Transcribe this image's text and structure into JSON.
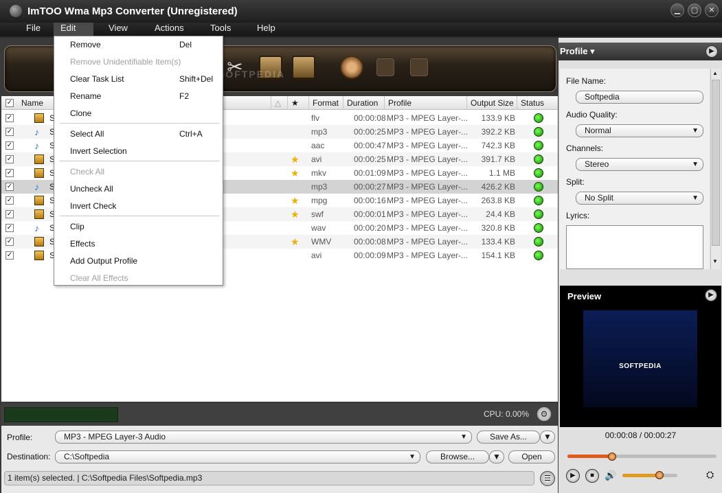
{
  "window": {
    "title": "ImTOO Wma Mp3 Converter (Unregistered)"
  },
  "menubar": [
    "File",
    "Edit",
    "View",
    "Actions",
    "Tools",
    "Help"
  ],
  "edit_menu": {
    "items": [
      {
        "label": "Remove",
        "shortcut": "Del",
        "disabled": false
      },
      {
        "label": "Remove Unidentifiable Item(s)",
        "shortcut": "",
        "disabled": true
      },
      {
        "label": "Clear Task List",
        "shortcut": "Shift+Del",
        "disabled": false
      },
      {
        "label": "Rename",
        "shortcut": "F2",
        "disabled": false
      },
      {
        "label": "Clone",
        "shortcut": "",
        "disabled": false
      },
      {
        "label": "Select All",
        "shortcut": "Ctrl+A",
        "disabled": false
      },
      {
        "label": "Invert Selection",
        "shortcut": "",
        "disabled": false
      },
      {
        "label": "Check All",
        "shortcut": "",
        "disabled": true
      },
      {
        "label": "Uncheck All",
        "shortcut": "",
        "disabled": false
      },
      {
        "label": "Invert Check",
        "shortcut": "",
        "disabled": false
      },
      {
        "label": "Clip",
        "shortcut": "",
        "disabled": false
      },
      {
        "label": "Effects",
        "shortcut": "",
        "disabled": false
      },
      {
        "label": "Add Output Profile",
        "shortcut": "",
        "disabled": false
      },
      {
        "label": "Clear All Effects",
        "shortcut": "",
        "disabled": true
      }
    ]
  },
  "watermark": "SOFTPEDIA",
  "list": {
    "headers": {
      "name": "Name",
      "format": "Format",
      "duration": "Duration",
      "profile": "Profile",
      "output_size": "Output Size",
      "status": "Status"
    },
    "rows": [
      {
        "name": "S",
        "type": "video",
        "star": false,
        "format": "flv",
        "duration": "00:00:08",
        "profile": "MP3 - MPEG Layer-...",
        "size": "133.9 KB",
        "selected": false
      },
      {
        "name": "S",
        "type": "audio",
        "star": false,
        "format": "mp3",
        "duration": "00:00:25",
        "profile": "MP3 - MPEG Layer-...",
        "size": "392.2 KB",
        "selected": false
      },
      {
        "name": "S",
        "type": "audio",
        "star": false,
        "format": "aac",
        "duration": "00:00:47",
        "profile": "MP3 - MPEG Layer-...",
        "size": "742.3 KB",
        "selected": false
      },
      {
        "name": "S",
        "type": "video",
        "star": true,
        "format": "avi",
        "duration": "00:00:25",
        "profile": "MP3 - MPEG Layer-...",
        "size": "391.7 KB",
        "selected": false
      },
      {
        "name": "S",
        "type": "video",
        "star": true,
        "format": "mkv",
        "duration": "00:01:09",
        "profile": "MP3 - MPEG Layer-...",
        "size": "1.1 MB",
        "selected": false
      },
      {
        "name": "S",
        "type": "audio",
        "star": false,
        "format": "mp3",
        "duration": "00:00:27",
        "profile": "MP3 - MPEG Layer-...",
        "size": "426.2 KB",
        "selected": true
      },
      {
        "name": "S",
        "type": "video",
        "star": true,
        "format": "mpg",
        "duration": "00:00:16",
        "profile": "MP3 - MPEG Layer-...",
        "size": "263.8 KB",
        "selected": false
      },
      {
        "name": "S",
        "type": "video",
        "star": true,
        "format": "swf",
        "duration": "00:00:01",
        "profile": "MP3 - MPEG Layer-...",
        "size": "24.4 KB",
        "selected": false
      },
      {
        "name": "S",
        "type": "audio",
        "star": false,
        "format": "wav",
        "duration": "00:00:20",
        "profile": "MP3 - MPEG Layer-...",
        "size": "320.8 KB",
        "selected": false
      },
      {
        "name": "S",
        "type": "video",
        "star": true,
        "format": "WMV",
        "duration": "00:00:08",
        "profile": "MP3 - MPEG Layer-...",
        "size": "133.4 KB",
        "selected": false
      },
      {
        "name": "S",
        "type": "video",
        "star": false,
        "format": "avi",
        "duration": "00:00:09",
        "profile": "MP3 - MPEG Layer-...",
        "size": "154.1 KB",
        "selected": false
      }
    ]
  },
  "cpu": "CPU: 0.00%",
  "bottom": {
    "profile_label": "Profile:",
    "profile_value": "MP3 - MPEG Layer-3 Audio",
    "save_as": "Save As...",
    "destination_label": "Destination:",
    "destination_value": "C:\\Softpedia",
    "browse": "Browse...",
    "open": "Open",
    "status": "1 item(s) selected. | C:\\Softpedia Files\\Softpedia.mp3"
  },
  "right_panel": {
    "header": "Profile",
    "file_name_label": "File Name:",
    "file_name_value": "Softpedia",
    "audio_quality_label": "Audio Quality:",
    "audio_quality_value": "Normal",
    "channels_label": "Channels:",
    "channels_value": "Stereo",
    "split_label": "Split:",
    "split_value": "No Split",
    "lyrics_label": "Lyrics:"
  },
  "preview": {
    "title": "Preview",
    "logo": "SOFTPEDIA",
    "time": "00:00:08 / 00:00:27",
    "seek_fraction": 0.3,
    "volume_fraction": 0.67
  },
  "colors": {
    "accent": "#e05a1e",
    "status_ok": "#22c800"
  },
  "icons": [
    "film-icon",
    "music-note-icon",
    "star-icon",
    "status-ok-icon",
    "gear-icon",
    "play-icon",
    "stop-icon",
    "speaker-icon",
    "scissors-icon",
    "convert-icon",
    "pause-icon"
  ]
}
